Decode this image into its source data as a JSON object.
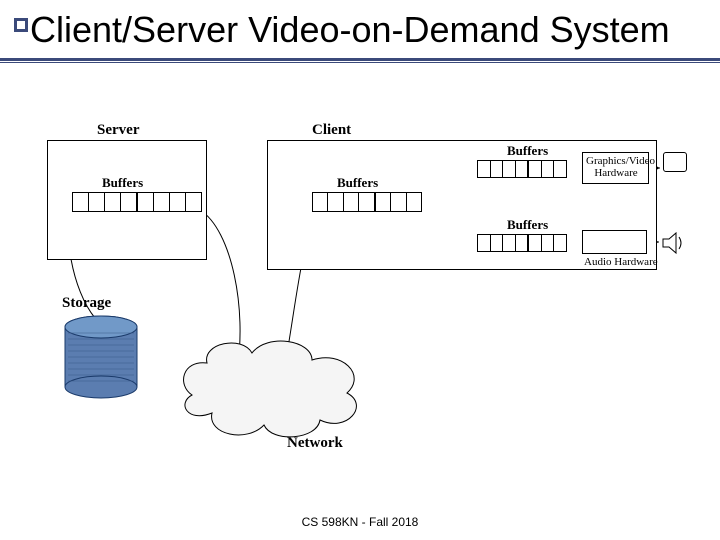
{
  "title": "Client/Server Video-on-Demand System",
  "footer": "CS 598KN - Fall 2018",
  "labels": {
    "server": "Server",
    "client": "Client",
    "storage": "Storage",
    "network": "Network",
    "buffers": "Buffers",
    "graphicsHW": "Graphics/Video Hardware",
    "audioHW": "Audio Hardware"
  }
}
